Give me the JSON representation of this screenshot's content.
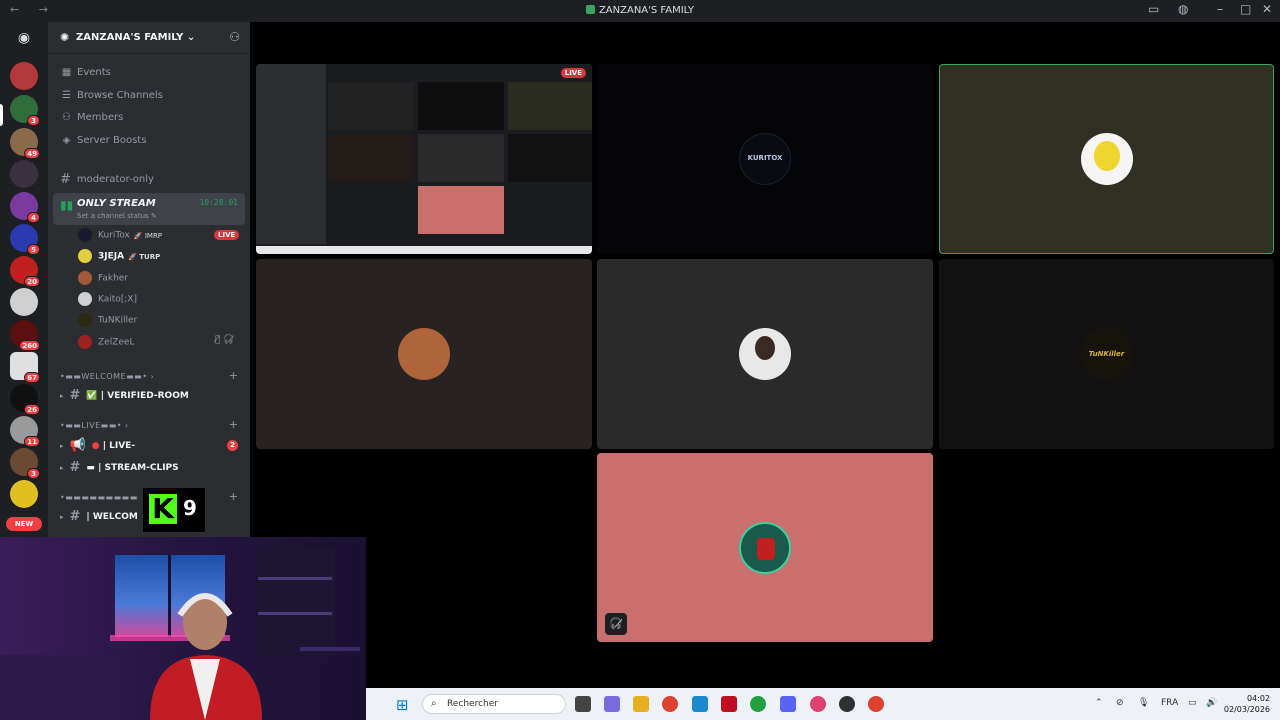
{
  "window": {
    "title": "ZANZANA'S FAMILY"
  },
  "server": {
    "name": "ZANZANA'S FAMILY",
    "nav": [
      {
        "icon": "calendar-icon",
        "label": "Events"
      },
      {
        "icon": "browse-icon",
        "label": "Browse Channels"
      },
      {
        "icon": "members-icon",
        "label": "Members"
      },
      {
        "icon": "boost-icon",
        "label": "Server Boosts"
      }
    ],
    "channels": {
      "moderator": "moderator-only",
      "voice": {
        "name": "ONLY STREAM",
        "status": "Set a channel status",
        "timer": "10:28:01",
        "live_label": "LIVE"
      },
      "users": [
        {
          "name": "KuriTox",
          "tag": "IMRP",
          "live": true
        },
        {
          "name": "3JEJA",
          "tag": "TURP",
          "live": false
        },
        {
          "name": "Fakher",
          "tag": "",
          "live": false
        },
        {
          "name": "Kaito[;X]",
          "tag": "",
          "live": false
        },
        {
          "name": "TuNKiller",
          "tag": "",
          "live": false
        },
        {
          "name": "ZelZeeL",
          "tag": "",
          "live": false
        }
      ],
      "cat_welcome": "•▬▬WELCOME▬▬•",
      "verified_room": "| VERIFIED-ROOM",
      "cat_live": "•▬▬LIVE▬▬•",
      "live_channel": "| LIVE-",
      "live_mentions": "2",
      "stream_clips": "| STREAM-CLIPS",
      "cat_other": "•▬▬▬▬▬▬▬▬▬",
      "welcome": "| WELCOM"
    }
  },
  "rail": {
    "badges": [
      "3",
      "49",
      "",
      "4",
      "5",
      "20",
      "",
      "260",
      "67",
      "26",
      "11",
      "3",
      ""
    ],
    "new_label": "NEW"
  },
  "stage": {
    "live_label": "LIVE",
    "kuritox_logo": "KURITOX",
    "tunkiller_logo": "TuNKiller"
  },
  "overlay": {
    "k": "K",
    "number": "9"
  },
  "taskbar": {
    "search_placeholder": "Rechercher",
    "lang": "FRA",
    "time": "04:02",
    "date": "02/03/2026"
  },
  "colors": {
    "accent_green": "#23a559",
    "live_red": "#da373c",
    "tile_pink": "#c9706e",
    "speaking_border": "#3ba55d"
  }
}
